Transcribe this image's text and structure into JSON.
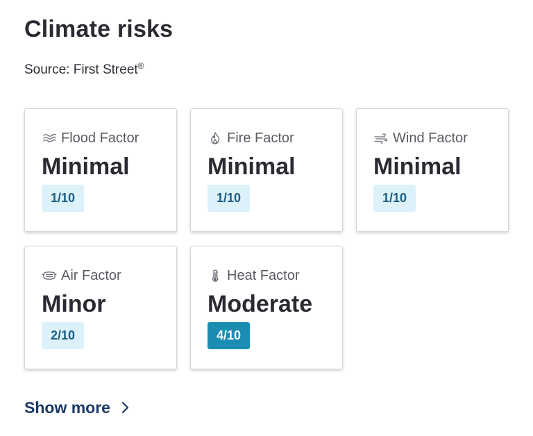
{
  "header": {
    "title": "Climate risks",
    "source_prefix": "Source: First Street",
    "source_mark": "®"
  },
  "factors": [
    {
      "icon": "flood-icon",
      "name": "Flood Factor",
      "level": "Minimal",
      "score": "1/10"
    },
    {
      "icon": "fire-icon",
      "name": "Fire Factor",
      "level": "Minimal",
      "score": "1/10"
    },
    {
      "icon": "wind-icon",
      "name": "Wind Factor",
      "level": "Minimal",
      "score": "1/10"
    },
    {
      "icon": "air-icon",
      "name": "Air Factor",
      "level": "Minor",
      "score": "2/10"
    },
    {
      "icon": "heat-icon",
      "name": "Heat Factor",
      "level": "Moderate",
      "score": "4/10"
    }
  ],
  "colors": {
    "score_light_bg": "#dcf1fa",
    "score_dark_bg": "#1b8db3",
    "link": "#1c3a66"
  },
  "footer": {
    "show_more_label": "Show more"
  }
}
